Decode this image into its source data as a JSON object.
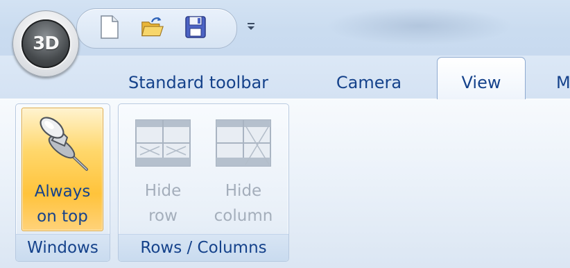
{
  "app_button": {
    "label": "3D",
    "icon": "app-logo-icon"
  },
  "quick_access_toolbar": {
    "buttons": [
      {
        "name": "new",
        "icon": "new-document-icon"
      },
      {
        "name": "open",
        "icon": "open-folder-icon"
      },
      {
        "name": "save",
        "icon": "save-disk-icon"
      }
    ],
    "dropdown_icon": "customize-toolbar-dropdown-icon"
  },
  "tabs": [
    {
      "label": "Standard toolbar",
      "active": false
    },
    {
      "label": "Camera",
      "active": false
    },
    {
      "label": "View",
      "active": true
    },
    {
      "label": "M",
      "active": false
    }
  ],
  "groups": {
    "windows": {
      "label": "Windows",
      "buttons": [
        {
          "label_line1": "Always",
          "label_line2": "on top",
          "icon": "pushpin-icon",
          "highlighted": true
        }
      ]
    },
    "rows_columns": {
      "label": "Rows / Columns",
      "buttons": [
        {
          "label_line1": "Hide",
          "label_line2": "row",
          "icon": "hide-row-icon",
          "enabled": false
        },
        {
          "label_line1": "Hide",
          "label_line2": "column",
          "icon": "hide-column-icon",
          "enabled": false
        }
      ]
    }
  },
  "colors": {
    "tab_text": "#15428b",
    "disabled_text": "#a4aebb",
    "highlight": "#ffc33b"
  }
}
